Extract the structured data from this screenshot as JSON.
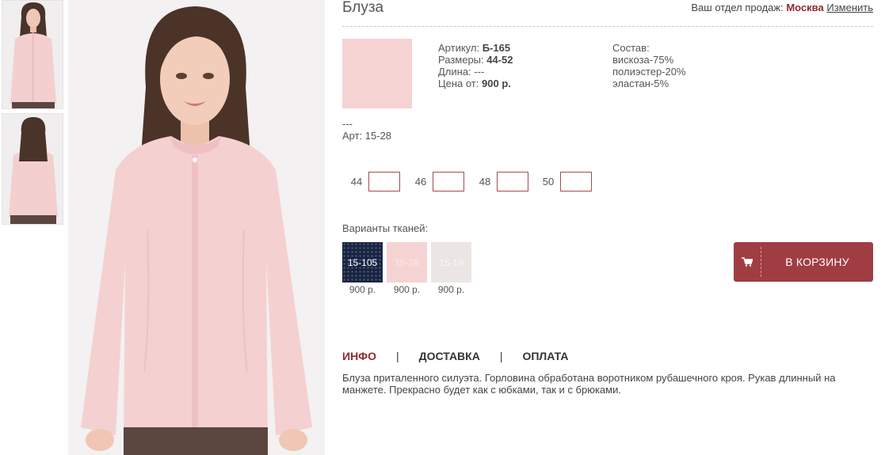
{
  "header": {
    "title": "Блуза",
    "sales_label": "Ваш отдел продаж:",
    "city": "Москва",
    "change_link": "Изменить"
  },
  "specs": {
    "article_label": "Артикул:",
    "article_value": "Б-165",
    "sizes_label": "Размеры:",
    "sizes_value": "44-52",
    "length_label": "Длина:",
    "length_value": "---",
    "price_label": "Цена от:",
    "price_value": "900 р."
  },
  "composition": {
    "label": "Состав:",
    "items": [
      "вискоза-75%",
      "полиэстер-20%",
      "эластан-5%"
    ]
  },
  "selected_fabric": {
    "dash": "---",
    "art": "Арт: 15-28",
    "color": "#f6d3d3"
  },
  "sizes": [
    "44",
    "46",
    "48",
    "50"
  ],
  "fabrics": {
    "label": "Варианты тканей:",
    "items": [
      {
        "code": "15-105",
        "price": "900 р."
      },
      {
        "code": "15-28",
        "price": "900 р."
      },
      {
        "code": "15-19",
        "price": "900 р."
      }
    ]
  },
  "cart_button": {
    "label": "В КОРЗИНУ",
    "icon": "cart-icon"
  },
  "tabs": [
    "ИНФО",
    "ДОСТАВКА",
    "ОПЛАТА"
  ],
  "tab_separator": "|",
  "description": "Блуза приталенного силуэта. Горловина обработана воротником рубашечного кроя. Рукав длинный на манжете. Прекрасно будет как с юбками, так и с брюками.",
  "colors": {
    "accent": "#a03d43",
    "blouse": "#f6d3d3"
  }
}
